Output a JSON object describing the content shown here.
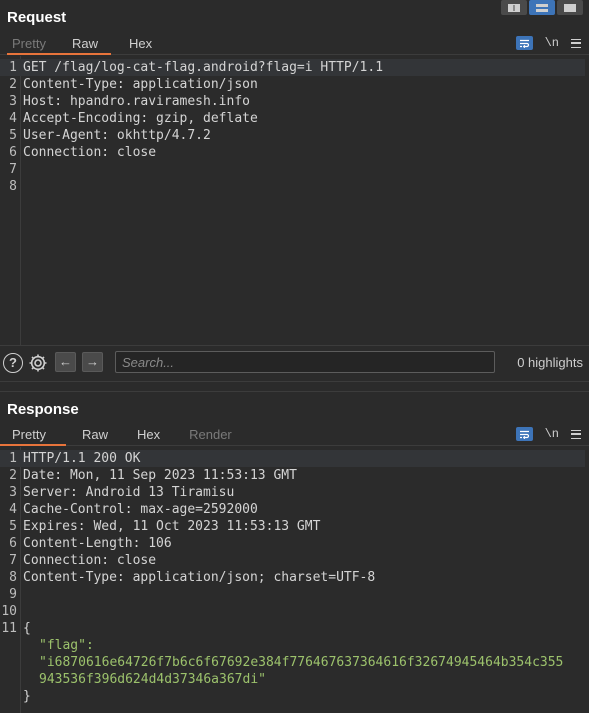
{
  "layout_toggle": [
    "split-vertical",
    "split-horizontal",
    "single-pane"
  ],
  "request": {
    "title": "Request",
    "tabs": [
      "Pretty",
      "Raw",
      "Hex"
    ],
    "active_tab": "Raw",
    "line_numbers": [
      "1",
      "2",
      "3",
      "4",
      "5",
      "6",
      "7",
      "8"
    ],
    "lines": [
      "GET /flag/log-cat-flag.android?flag=i HTTP/1.1",
      "Content-Type: application/json",
      "Host: hpandro.raviramesh.info",
      "Accept-Encoding: gzip, deflate",
      "User-Agent: okhttp/4.7.2",
      "Connection: close",
      "",
      ""
    ]
  },
  "search": {
    "placeholder": "Search...",
    "value": "",
    "highlights": "0 highlights"
  },
  "response": {
    "title": "Response",
    "tabs": [
      "Pretty",
      "Raw",
      "Hex",
      "Render"
    ],
    "active_tab": "Pretty",
    "line_numbers": [
      "1",
      "2",
      "3",
      "4",
      "5",
      "6",
      "7",
      "8",
      "9",
      "10",
      "11"
    ],
    "lines": [
      "HTTP/1.1 200 OK",
      "Date: Mon, 11 Sep 2023 11:53:13 GMT",
      "Server: Android 13 Tiramisu",
      "Cache-Control: max-age=2592000",
      "Expires: Wed, 11 Oct 2023 11:53:13 GMT",
      "Content-Length: 106",
      "Connection: close",
      "Content-Type: application/json; charset=UTF-8",
      "",
      "",
      "{"
    ],
    "json_key": "\"flag\":",
    "json_value_1": "\"i6870616e64726f7b6c6f67692e384f776467637364616f32674945464b354c355",
    "json_value_2": "943536f396d624d4d37346a367di\"",
    "json_close": "}"
  },
  "icons": {
    "wrap": "word-wrap-icon",
    "newline": "\\n",
    "menu": "hamburger-menu-icon",
    "help": "?",
    "settings": "gear-icon",
    "back": "←",
    "forward": "→"
  },
  "colors": {
    "background": "#2b2b2b",
    "accent_tab_underline": "#e8743b",
    "accent_blue": "#3d74b8",
    "json_string": "#9cc26c"
  }
}
